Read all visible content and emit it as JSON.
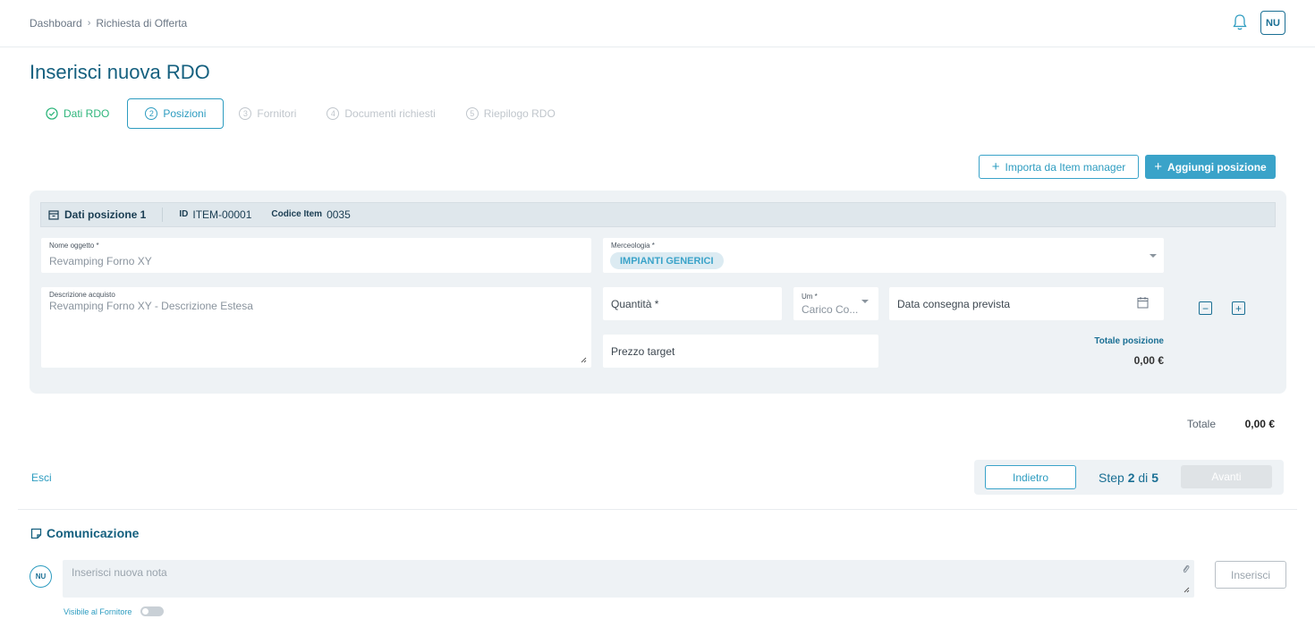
{
  "breadcrumb": {
    "home": "Dashboard",
    "separator": "›",
    "current": "Richiesta di Offerta"
  },
  "header": {
    "avatar": "NU",
    "notification_icon": "bell-icon"
  },
  "page": {
    "title": "Inserisci nuova RDO"
  },
  "steps": [
    {
      "num": "✓",
      "label": "Dati RDO",
      "state": "done"
    },
    {
      "num": "2",
      "label": "Posizioni",
      "state": "active"
    },
    {
      "num": "3",
      "label": "Fornitori",
      "state": "inactive"
    },
    {
      "num": "4",
      "label": "Documenti richiesti",
      "state": "inactive"
    },
    {
      "num": "5",
      "label": "Riepilogo RDO",
      "state": "inactive"
    }
  ],
  "actions": {
    "import_label": "Importa da Item manager",
    "add_label": "Aggiungi posizione",
    "plus": "+"
  },
  "position": {
    "title": "Dati posizione 1",
    "id_label": "ID",
    "id_value": "ITEM-00001",
    "code_label": "Codice Item",
    "code_value": "0035",
    "nome_label": "Nome oggetto *",
    "nome_value": "Revamping Forno XY",
    "merceologia_label": "Merceologia *",
    "merceologia_value": "IMPIANTI GENERICI",
    "descrizione_label": "Descrizione acquisto",
    "descrizione_value": "Revamping Forno XY - Descrizione Estesa",
    "quantita_placeholder": "Quantità *",
    "um_label": "Um *",
    "um_value": "Carico Co...",
    "data_placeholder": "Data consegna prevista",
    "prezzo_placeholder": "Prezzo target",
    "totale_label": "Totale posizione",
    "totale_value": "0,00 €",
    "minus": "−",
    "plus": "+"
  },
  "summary": {
    "totale_label": "Totale",
    "totale_value": "0,00 €"
  },
  "nav": {
    "exit_label": "Esci",
    "back_label": "Indietro",
    "step_prefix": "Step",
    "step_current": "2",
    "step_of": "di",
    "step_total": "5",
    "next_label": "Avanti"
  },
  "comunicazione": {
    "title": "Comunicazione",
    "avatar": "NU",
    "placeholder": "Inserisci nuova nota",
    "submit_label": "Inserisci",
    "visibility_label": "Visibile al Fornitore",
    "visibility_on": false
  },
  "colors": {
    "primary": "#3aa3c9",
    "dark": "#15607f",
    "success": "#2fb67c",
    "panel": "#eef2f5"
  }
}
